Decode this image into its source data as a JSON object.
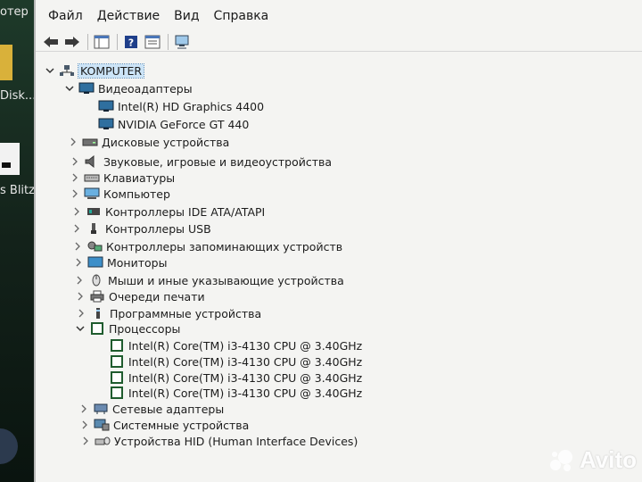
{
  "desktop": {
    "label1": "отер",
    "label2": "Disk...",
    "label3": "s Blitz"
  },
  "menu": [
    "Файл",
    "Действие",
    "Вид",
    "Справка"
  ],
  "tree": {
    "root": "KOMPUTER",
    "video": {
      "label": "Видеоадаптеры",
      "children": [
        "Intel(R) HD Graphics 4400",
        "NVIDIA GeForce GT 440"
      ]
    },
    "categories": [
      "Дисковые устройства",
      "Звуковые, игровые и видеоустройства",
      "Клавиатуры",
      "Компьютер",
      "Контроллеры IDE ATA/ATAPI",
      "Контроллеры USB",
      "Контроллеры запоминающих устройств",
      "Мониторы",
      "Мыши и иные указывающие устройства",
      "Очереди печати",
      "Программные устройства"
    ],
    "cpu": {
      "label": "Процессоры",
      "children": [
        "Intel(R) Core(TM) i3-4130 CPU @ 3.40GHz",
        "Intel(R) Core(TM) i3-4130 CPU @ 3.40GHz",
        "Intel(R) Core(TM) i3-4130 CPU @ 3.40GHz",
        "Intel(R) Core(TM) i3-4130 CPU @ 3.40GHz"
      ]
    },
    "after": [
      "Сетевые адаптеры",
      "Системные устройства",
      "Устройства HID (Human Interface Devices)"
    ]
  },
  "watermark": "Avito"
}
